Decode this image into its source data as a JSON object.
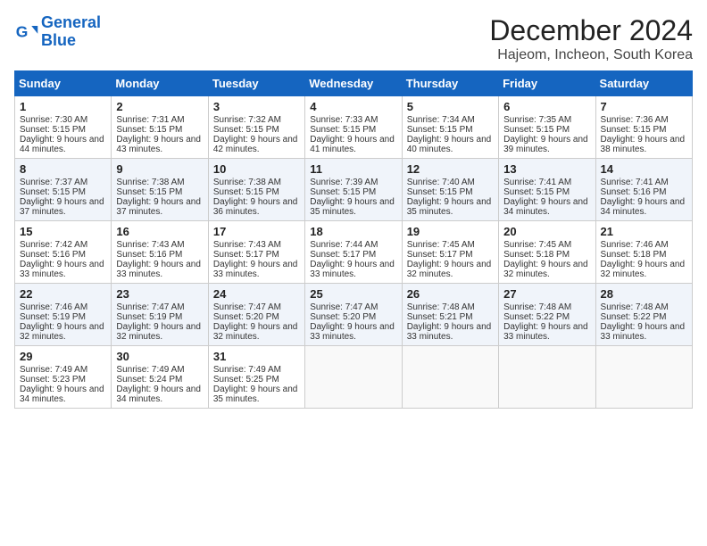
{
  "header": {
    "logo_line1": "General",
    "logo_line2": "Blue",
    "month_title": "December 2024",
    "location": "Hajeom, Incheon, South Korea"
  },
  "weekdays": [
    "Sunday",
    "Monday",
    "Tuesday",
    "Wednesday",
    "Thursday",
    "Friday",
    "Saturday"
  ],
  "weeks": [
    [
      {
        "day": "1",
        "sunrise": "Sunrise: 7:30 AM",
        "sunset": "Sunset: 5:15 PM",
        "daylight": "Daylight: 9 hours and 44 minutes."
      },
      {
        "day": "2",
        "sunrise": "Sunrise: 7:31 AM",
        "sunset": "Sunset: 5:15 PM",
        "daylight": "Daylight: 9 hours and 43 minutes."
      },
      {
        "day": "3",
        "sunrise": "Sunrise: 7:32 AM",
        "sunset": "Sunset: 5:15 PM",
        "daylight": "Daylight: 9 hours and 42 minutes."
      },
      {
        "day": "4",
        "sunrise": "Sunrise: 7:33 AM",
        "sunset": "Sunset: 5:15 PM",
        "daylight": "Daylight: 9 hours and 41 minutes."
      },
      {
        "day": "5",
        "sunrise": "Sunrise: 7:34 AM",
        "sunset": "Sunset: 5:15 PM",
        "daylight": "Daylight: 9 hours and 40 minutes."
      },
      {
        "day": "6",
        "sunrise": "Sunrise: 7:35 AM",
        "sunset": "Sunset: 5:15 PM",
        "daylight": "Daylight: 9 hours and 39 minutes."
      },
      {
        "day": "7",
        "sunrise": "Sunrise: 7:36 AM",
        "sunset": "Sunset: 5:15 PM",
        "daylight": "Daylight: 9 hours and 38 minutes."
      }
    ],
    [
      {
        "day": "8",
        "sunrise": "Sunrise: 7:37 AM",
        "sunset": "Sunset: 5:15 PM",
        "daylight": "Daylight: 9 hours and 37 minutes."
      },
      {
        "day": "9",
        "sunrise": "Sunrise: 7:38 AM",
        "sunset": "Sunset: 5:15 PM",
        "daylight": "Daylight: 9 hours and 37 minutes."
      },
      {
        "day": "10",
        "sunrise": "Sunrise: 7:38 AM",
        "sunset": "Sunset: 5:15 PM",
        "daylight": "Daylight: 9 hours and 36 minutes."
      },
      {
        "day": "11",
        "sunrise": "Sunrise: 7:39 AM",
        "sunset": "Sunset: 5:15 PM",
        "daylight": "Daylight: 9 hours and 35 minutes."
      },
      {
        "day": "12",
        "sunrise": "Sunrise: 7:40 AM",
        "sunset": "Sunset: 5:15 PM",
        "daylight": "Daylight: 9 hours and 35 minutes."
      },
      {
        "day": "13",
        "sunrise": "Sunrise: 7:41 AM",
        "sunset": "Sunset: 5:15 PM",
        "daylight": "Daylight: 9 hours and 34 minutes."
      },
      {
        "day": "14",
        "sunrise": "Sunrise: 7:41 AM",
        "sunset": "Sunset: 5:16 PM",
        "daylight": "Daylight: 9 hours and 34 minutes."
      }
    ],
    [
      {
        "day": "15",
        "sunrise": "Sunrise: 7:42 AM",
        "sunset": "Sunset: 5:16 PM",
        "daylight": "Daylight: 9 hours and 33 minutes."
      },
      {
        "day": "16",
        "sunrise": "Sunrise: 7:43 AM",
        "sunset": "Sunset: 5:16 PM",
        "daylight": "Daylight: 9 hours and 33 minutes."
      },
      {
        "day": "17",
        "sunrise": "Sunrise: 7:43 AM",
        "sunset": "Sunset: 5:17 PM",
        "daylight": "Daylight: 9 hours and 33 minutes."
      },
      {
        "day": "18",
        "sunrise": "Sunrise: 7:44 AM",
        "sunset": "Sunset: 5:17 PM",
        "daylight": "Daylight: 9 hours and 33 minutes."
      },
      {
        "day": "19",
        "sunrise": "Sunrise: 7:45 AM",
        "sunset": "Sunset: 5:17 PM",
        "daylight": "Daylight: 9 hours and 32 minutes."
      },
      {
        "day": "20",
        "sunrise": "Sunrise: 7:45 AM",
        "sunset": "Sunset: 5:18 PM",
        "daylight": "Daylight: 9 hours and 32 minutes."
      },
      {
        "day": "21",
        "sunrise": "Sunrise: 7:46 AM",
        "sunset": "Sunset: 5:18 PM",
        "daylight": "Daylight: 9 hours and 32 minutes."
      }
    ],
    [
      {
        "day": "22",
        "sunrise": "Sunrise: 7:46 AM",
        "sunset": "Sunset: 5:19 PM",
        "daylight": "Daylight: 9 hours and 32 minutes."
      },
      {
        "day": "23",
        "sunrise": "Sunrise: 7:47 AM",
        "sunset": "Sunset: 5:19 PM",
        "daylight": "Daylight: 9 hours and 32 minutes."
      },
      {
        "day": "24",
        "sunrise": "Sunrise: 7:47 AM",
        "sunset": "Sunset: 5:20 PM",
        "daylight": "Daylight: 9 hours and 32 minutes."
      },
      {
        "day": "25",
        "sunrise": "Sunrise: 7:47 AM",
        "sunset": "Sunset: 5:20 PM",
        "daylight": "Daylight: 9 hours and 33 minutes."
      },
      {
        "day": "26",
        "sunrise": "Sunrise: 7:48 AM",
        "sunset": "Sunset: 5:21 PM",
        "daylight": "Daylight: 9 hours and 33 minutes."
      },
      {
        "day": "27",
        "sunrise": "Sunrise: 7:48 AM",
        "sunset": "Sunset: 5:22 PM",
        "daylight": "Daylight: 9 hours and 33 minutes."
      },
      {
        "day": "28",
        "sunrise": "Sunrise: 7:48 AM",
        "sunset": "Sunset: 5:22 PM",
        "daylight": "Daylight: 9 hours and 33 minutes."
      }
    ],
    [
      {
        "day": "29",
        "sunrise": "Sunrise: 7:49 AM",
        "sunset": "Sunset: 5:23 PM",
        "daylight": "Daylight: 9 hours and 34 minutes."
      },
      {
        "day": "30",
        "sunrise": "Sunrise: 7:49 AM",
        "sunset": "Sunset: 5:24 PM",
        "daylight": "Daylight: 9 hours and 34 minutes."
      },
      {
        "day": "31",
        "sunrise": "Sunrise: 7:49 AM",
        "sunset": "Sunset: 5:25 PM",
        "daylight": "Daylight: 9 hours and 35 minutes."
      },
      null,
      null,
      null,
      null
    ]
  ]
}
